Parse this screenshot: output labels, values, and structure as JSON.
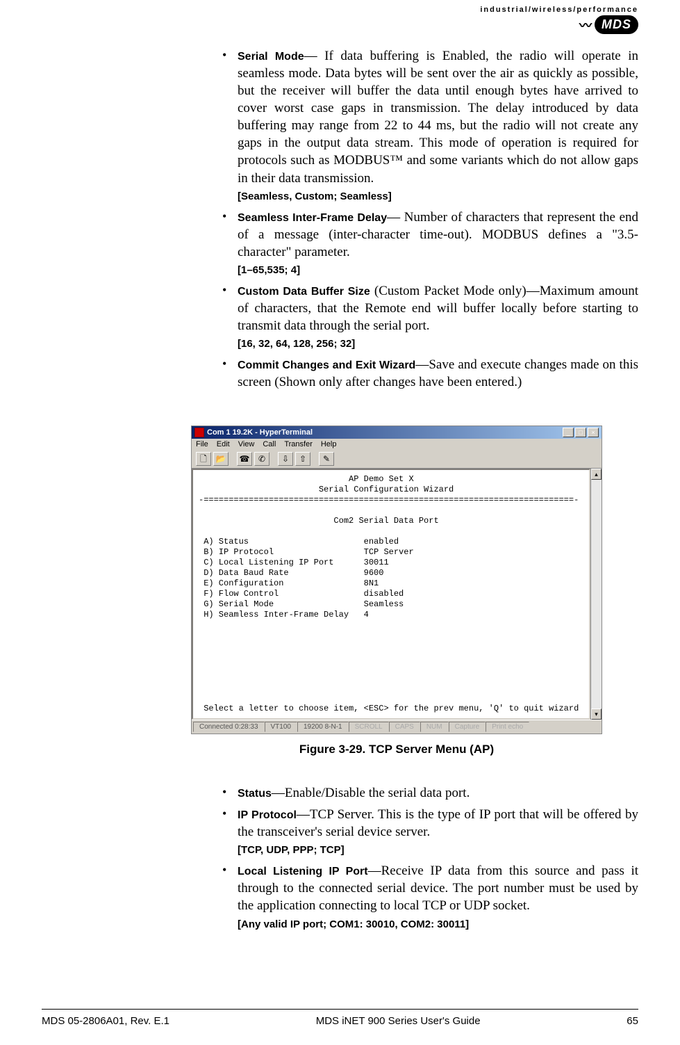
{
  "header": {
    "tagline": "industrial/wireless/performance",
    "logo": "MDS"
  },
  "bullets_top": [
    {
      "term": "Serial Mode",
      "desc": "— If data buffering is Enabled, the radio will operate in seamless mode. Data bytes will be sent over the air as quickly as possible, but the receiver will buffer the data until enough bytes have arrived to cover worst case gaps in transmission. The delay introduced by data buffering may range from 22 to 44 ms, but the radio will not create any gaps in the output data stream. This mode of operation is required for protocols such as MODBUS™ and some variants which do not allow gaps in their data transmission.",
      "options": "[Seamless, Custom; Seamless]"
    },
    {
      "term": "Seamless Inter-Frame Delay",
      "desc": "— Number of characters that represent the end of a message (inter-character time-out). MODBUS defines a \"3.5-character\" parameter.",
      "options": "[1–65,535; 4]"
    },
    {
      "term": "Custom Data Buffer Size",
      "desc": " (Custom Packet Mode only)—Maximum amount of characters, that the Remote end will buffer locally before starting to transmit data through the serial port.",
      "options": "[16, 32, 64, 128, 256; 32]"
    },
    {
      "term": "Commit Changes and Exit Wizard",
      "desc": "—Save and execute changes made on this screen (Shown only after changes have been entered.)",
      "options": ""
    }
  ],
  "terminal": {
    "title": "Com 1 19.2K - HyperTerminal",
    "menu": [
      "File",
      "Edit",
      "View",
      "Call",
      "Transfer",
      "Help"
    ],
    "body_title1": "AP Demo Set X",
    "body_title2": "Serial Configuration Wizard",
    "divider": "-==========================================================================-",
    "section": "Com2 Serial Data Port",
    "rows": [
      {
        "k": "A) Status",
        "v": "enabled"
      },
      {
        "k": "B) IP Protocol",
        "v": "TCP Server"
      },
      {
        "k": "C) Local Listening IP Port",
        "v": "30011"
      },
      {
        "k": "D) Data Baud Rate",
        "v": "9600"
      },
      {
        "k": "E) Configuration",
        "v": "8N1"
      },
      {
        "k": "F) Flow Control",
        "v": "disabled"
      },
      {
        "k": "G) Serial Mode",
        "v": "Seamless"
      },
      {
        "k": "H) Seamless Inter-Frame Delay",
        "v": "4"
      }
    ],
    "prompt": "Select a letter to choose item, <ESC> for the prev menu, 'Q' to quit wizard",
    "status": {
      "connected": "Connected 0:28:33",
      "emulation": "VT100",
      "settings": "19200 8-N-1",
      "scroll": "SCROLL",
      "caps": "CAPS",
      "num": "NUM",
      "capture": "Capture",
      "print": "Print echo"
    }
  },
  "figure_caption": "Figure 3-29. TCP Server Menu (AP)",
  "bullets_bottom": [
    {
      "term": "Status",
      "desc": "—Enable/Disable the serial data port.",
      "options": ""
    },
    {
      "term": "IP Protocol",
      "desc": "—TCP Server. This is the type of IP port that will be offered by the transceiver's serial device server.",
      "options": "[TCP, UDP, PPP; TCP]"
    },
    {
      "term": "Local Listening IP Port",
      "desc": "—Receive IP data from this source and pass it through to the connected serial device. The port number must be used by the application connecting to local TCP or UDP socket.",
      "options": "[Any valid IP port; COM1: 30010, COM2: 30011]"
    }
  ],
  "footer": {
    "left": "MDS 05-2806A01, Rev. E.1",
    "center": "MDS iNET 900 Series User's Guide",
    "right": "65"
  }
}
